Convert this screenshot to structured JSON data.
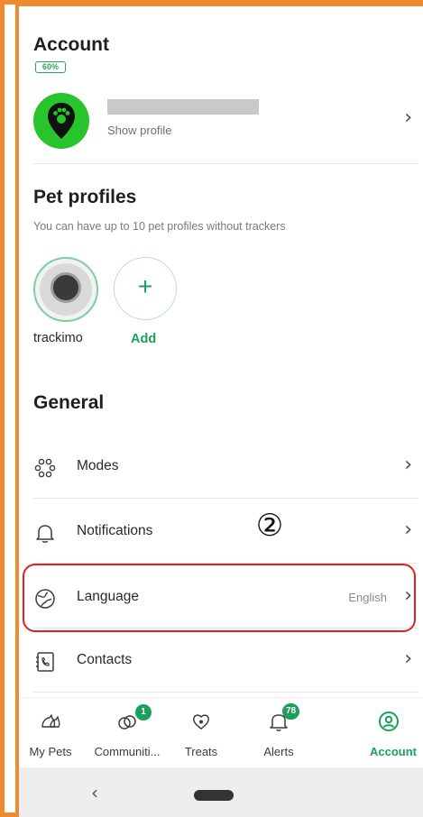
{
  "account": {
    "heading": "Account",
    "show_profile": "Show profile"
  },
  "pets": {
    "heading": "Pet profiles",
    "subtitle": "You can have up to 10 pet profiles without trackers",
    "items": [
      {
        "name": "trackimo",
        "battery": "60%",
        "battery_level": 0.6
      }
    ],
    "add_label": "Add",
    "add_symbol": "+"
  },
  "general": {
    "heading": "General",
    "items": [
      {
        "label": "Modes",
        "value": ""
      },
      {
        "label": "Notifications",
        "value": ""
      },
      {
        "label": "Language",
        "value": "English"
      },
      {
        "label": "Contacts",
        "value": ""
      }
    ]
  },
  "annotation": {
    "marker": "②"
  },
  "nav": {
    "items": [
      {
        "label": "My Pets",
        "badge": ""
      },
      {
        "label": "Communiti...",
        "badge": "1"
      },
      {
        "label": "Treats",
        "badge": ""
      },
      {
        "label": "Alerts",
        "badge": "78"
      },
      {
        "label": "Account",
        "badge": ""
      }
    ],
    "active": "Account"
  },
  "colors": {
    "accent": "#1aa05a",
    "avatar_green": "#27c42b",
    "frame_orange": "#ef8a2e",
    "highlight_red": "#e02020"
  },
  "icons": {
    "chevron": "chevron-right-icon",
    "modes": "modes-icon",
    "notifications": "bell-icon",
    "language": "globe-icon",
    "contacts": "contacts-book-icon"
  }
}
